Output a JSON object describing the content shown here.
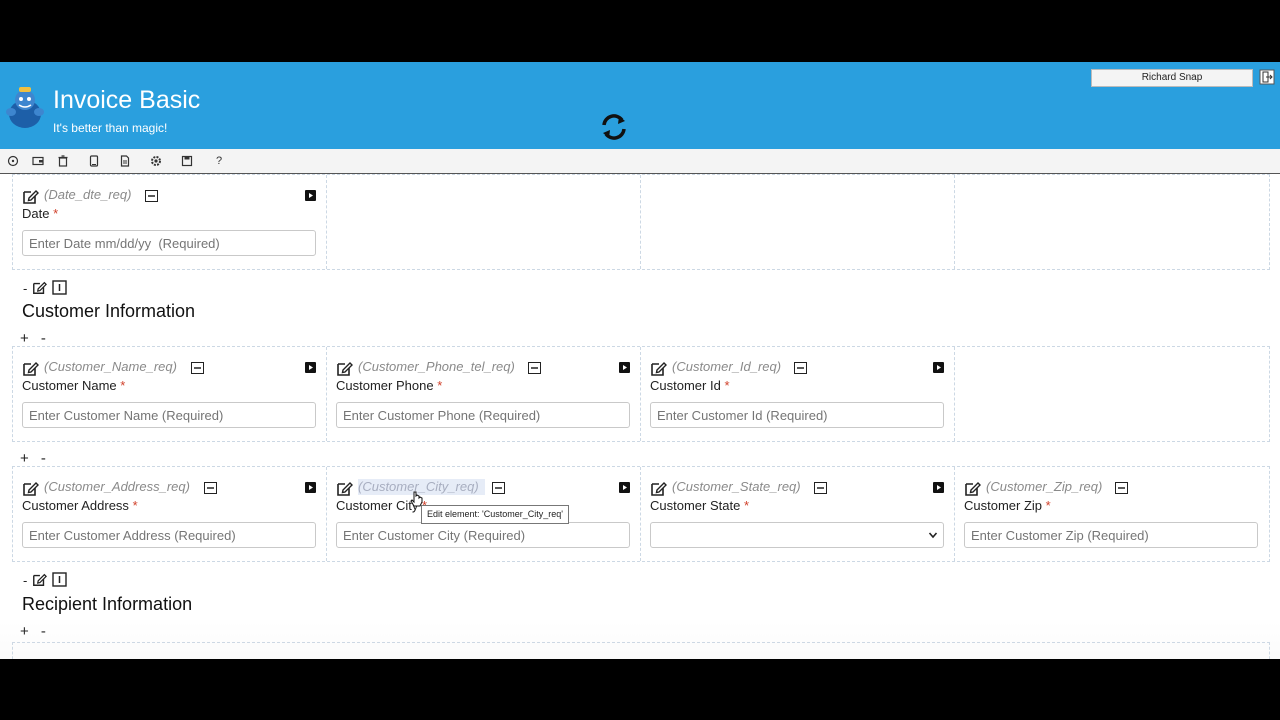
{
  "header": {
    "app_title": "Invoice Basic",
    "app_subtitle": "It's better than magic!",
    "user_name": "Richard Snap",
    "brand_color": "#2a9fde"
  },
  "toolbar": {
    "icons": [
      "palette-icon",
      "wallet-icon",
      "trash-icon",
      "tablet-icon",
      "document-icon",
      "gear-icon",
      "save-icon",
      "help-icon"
    ],
    "help_glyph": "?"
  },
  "sections": {
    "date_row": {
      "fields": [
        {
          "id": "(Date_dte_req)",
          "label": "Date",
          "required": "*",
          "placeholder": "Enter Date mm/dd/yy  (Required)"
        }
      ]
    },
    "customer": {
      "controls_prefix": "-",
      "title": "Customer Information",
      "add_remove": "+ -",
      "row1": [
        {
          "id": "(Customer_Name_req)",
          "label": "Customer Name",
          "required": "*",
          "placeholder": "Enter Customer Name (Required)"
        },
        {
          "id": "(Customer_Phone_tel_req)",
          "label": "Customer Phone",
          "required": "*",
          "placeholder": "Enter Customer Phone (Required)"
        },
        {
          "id": "(Customer_Id_req)",
          "label": "Customer Id",
          "required": "*",
          "placeholder": "Enter Customer Id (Required)"
        }
      ],
      "row2_add_remove": "+ -",
      "row2": [
        {
          "id": "(Customer_Address_req)",
          "label": "Customer Address",
          "required": "*",
          "placeholder": "Enter Customer Address (Required)"
        },
        {
          "id": "(Customer_City_req)",
          "label": "Customer City",
          "required": "*",
          "placeholder": "Enter Customer City (Required)"
        },
        {
          "id": "(Customer_State_req)",
          "label": "Customer State",
          "required": "*",
          "select_value": ""
        },
        {
          "id": "(Customer_Zip_req)",
          "label": "Customer Zip",
          "required": "*",
          "placeholder": "Enter Customer Zip (Required)"
        }
      ]
    },
    "recipient": {
      "controls_prefix": "-",
      "title": "Recipient Information",
      "add_remove": "+ -"
    }
  },
  "tooltip": {
    "text": "Edit element: 'Customer_City_req'"
  }
}
